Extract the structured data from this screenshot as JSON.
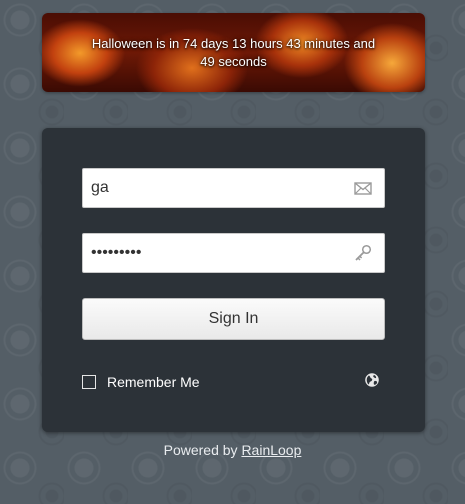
{
  "banner": {
    "text": "Halloween is in 74 days 13 hours 43 minutes and 49 seconds"
  },
  "login": {
    "email_value": "ga",
    "password_value": "•••••••••",
    "signin_label": "Sign In",
    "remember_label": "Remember Me"
  },
  "footer": {
    "powered_prefix": "Powered by ",
    "powered_link": "RainLoop"
  },
  "icons": {
    "email": "envelope-icon",
    "password": "key-icon",
    "language": "globe-icon"
  },
  "colors": {
    "background": "#545e66",
    "panel": "#2c3238",
    "banner_accent": "#e0701c"
  }
}
